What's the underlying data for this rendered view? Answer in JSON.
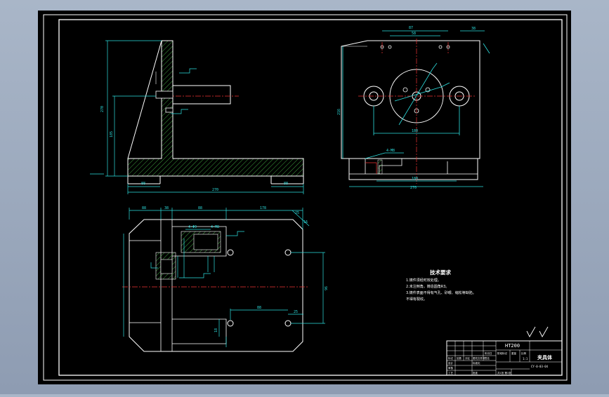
{
  "drawing": {
    "tech_title": "技术要求",
    "tech_notes": [
      "1.铸件须经时效处理。",
      "2.未注倒角，铸造圆角R3。",
      "3.铸件表面不得有气孔、砂眼、缩松等缺陷。",
      "不得有裂纹。"
    ],
    "material": "HT200",
    "part_name": "夹具体",
    "drawing_number": "CY-0-03-04",
    "scale": "1:1",
    "sheet": "共1张 第1张",
    "title_labels": [
      "标记",
      "处数",
      "分区",
      "更改文件号",
      "签名",
      "年月日",
      "设计",
      "标准化",
      "审核",
      "工艺",
      "批准",
      "阶段标记",
      "重量",
      "比例"
    ],
    "dims": {
      "side_height_1": "270",
      "side_height_2": "185",
      "side_base_left": "88",
      "side_base_right": "88",
      "side_length": "270",
      "top_width": "87",
      "top_width_2": "58",
      "top_right": "38",
      "top_height": "216",
      "top_bolt_span": "180",
      "top_base_width": "270",
      "top_inner": "180",
      "top_hole": "4-M8",
      "plan_d1": "88",
      "plan_d2": "38",
      "plan_d3": "88",
      "plan_d4": "178",
      "plan_d5": "25",
      "plan_d6": "16",
      "plan_d7": "4-Φ9",
      "plan_d8": "4-M8",
      "plan_d9": "88",
      "plan_d10": "25",
      "plan_d11": "18",
      "plan_height": "96"
    }
  }
}
